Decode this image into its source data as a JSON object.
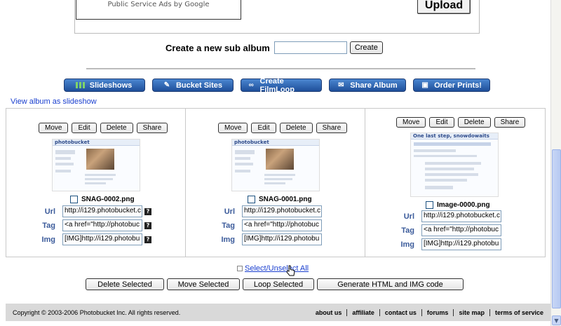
{
  "top": {
    "ad_text": "Public Service Ads by Google",
    "upload_label": "Upload"
  },
  "subalbum": {
    "label": "Create a new sub album",
    "input_value": "",
    "button_label": "Create"
  },
  "toolbar": {
    "buttons": [
      {
        "label": "Slideshows",
        "icon": "slideshow-icon"
      },
      {
        "label": "Bucket Sites",
        "icon": "bucket-icon"
      },
      {
        "label": "Create FilmLoop",
        "icon": "filmloop-icon"
      },
      {
        "label": "Share Album",
        "icon": "share-icon"
      },
      {
        "label": "Order Prints!",
        "icon": "prints-icon"
      }
    ]
  },
  "view_slideshow_link": "View album as slideshow",
  "actions": {
    "move": "Move",
    "edit": "Edit",
    "delete": "Delete",
    "share": "Share"
  },
  "images": [
    {
      "filename": "SNAG-0002.png",
      "url": "http://i129.photobucket.c",
      "tag": "<a href=\"http://photobuc",
      "img": "[IMG]http://i129.photobu",
      "thumb_title": "photobucket"
    },
    {
      "filename": "SNAG-0001.png",
      "url": "http://i129.photobucket.c",
      "tag": "<a href=\"http://photobuc",
      "img": "[IMG]http://i129.photobu",
      "thumb_title": "photobucket"
    },
    {
      "filename": "Image-0000.png",
      "url": "http://i129.photobucket.c",
      "tag": "<a href=\"http://photobuc",
      "img": "[IMG]http://i129.photobu",
      "thumb_title": "One last step, snowdowaits"
    }
  ],
  "field_labels": {
    "url": "Url",
    "tag": "Tag",
    "img": "Img"
  },
  "help_glyph": "?",
  "select_all": "Select/Unselect All",
  "bottom_buttons": {
    "delete_selected": "Delete Selected",
    "move_selected": "Move Selected",
    "loop_selected": "Loop Selected",
    "generate": "Generate HTML and IMG code"
  },
  "footer": {
    "copyright": "Copyright © 2003-2006 Photobucket Inc. All rights reserved.",
    "links": [
      "about us",
      "affiliate",
      "contact us",
      "forums",
      "site map",
      "terms of service"
    ]
  }
}
